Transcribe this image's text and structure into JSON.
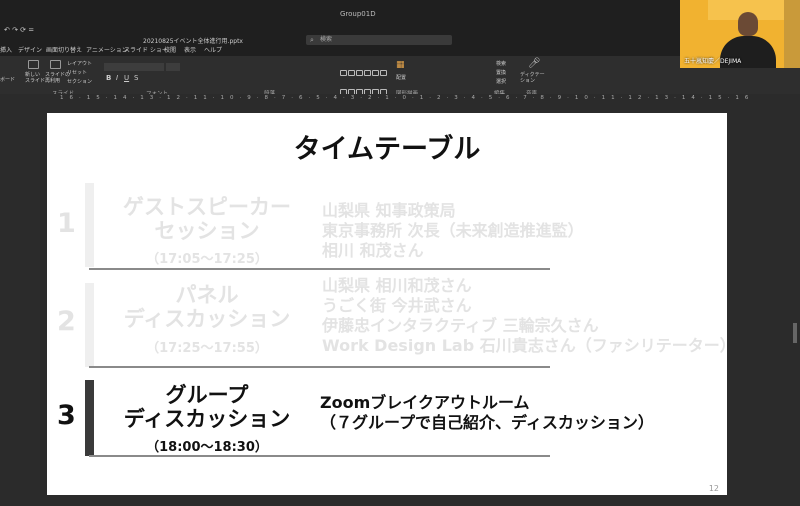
{
  "window": {
    "app_title": "Group01D",
    "filename": "20210825イベント全体進行用.pptx",
    "search_placeholder": "検索",
    "quick_access": "↶ ↷ ⟳ ="
  },
  "menu": {
    "tabs": [
      "挿入",
      "デザイン",
      "画面切り替え",
      "アニメーション",
      "スライド ショー",
      "校閲",
      "表示",
      "ヘルプ"
    ]
  },
  "ribbon": {
    "buttons": {
      "new_slide": "新しい\nスライド",
      "reuse": "スライドの\n再利用",
      "layout": "レイアウト",
      "reset": "リセット",
      "section": "セクション",
      "arrange": "配置",
      "find": "検索",
      "replace": "置換",
      "select": "選択",
      "dictate": "ディクテー\nション"
    },
    "groups": [
      "スライド",
      "フォント",
      "段落",
      "図形描画",
      "編集",
      "音声"
    ],
    "side_label": "ボード"
  },
  "ruler": {
    "numbers": "16·15·14·13·12·11·10·9·8·7·6·5·4·3·2·1·0·1·2·3·4·5·6·7·8·9·10·11·12·13·14·15·16"
  },
  "webcam": {
    "label": "五十嵐知慶／DEJIMA"
  },
  "slide": {
    "title": "タイムテーブル",
    "page_number": "12",
    "sessions": [
      {
        "number": "1",
        "title_line1": "ゲストスピーカー",
        "title_line2": "セッション",
        "time": "（17:05～17:25）",
        "desc": [
          "山梨県 知事政策局",
          "東京事務所 次長（未来創造推進監）",
          "相川 和茂さん"
        ]
      },
      {
        "number": "2",
        "title_line1": "パネル",
        "title_line2": "ディスカッション",
        "time": "（17:25～17:55）",
        "desc": [
          "山梨県 相川和茂さん",
          "うごく街 今井武さん",
          "伊藤忠インタラクティブ 三輪宗久さん",
          "Work Design Lab 石川貴志さん（ファシリテーター）"
        ]
      },
      {
        "number": "3",
        "title_line1": "グループ",
        "title_line2": "ディスカッション",
        "time": "（18:00～18:30）",
        "desc": [
          "Zoomブレイクアウトルーム",
          "（７グループで自己紹介、ディスカッション）"
        ]
      }
    ]
  }
}
